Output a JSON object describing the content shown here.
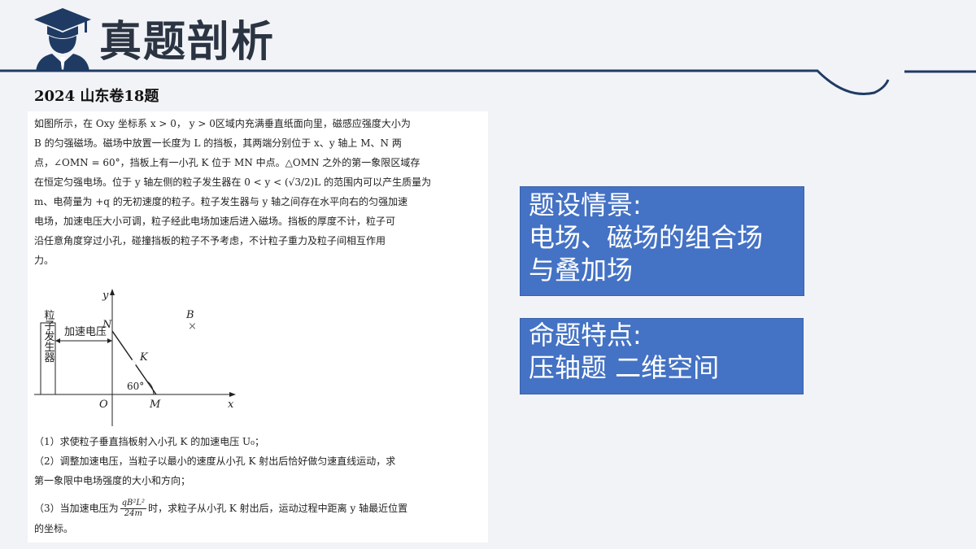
{
  "header": {
    "title": "真题剖析",
    "icon": "graduate-icon",
    "accent_color": "#1f3b63"
  },
  "subtitle": "2024 山东卷18题",
  "problem": {
    "lines": [
      "如图所示，在 Oxy 坐标系 x > 0，  y > 0区域内充满垂直纸面向里，磁感应强度大小为",
      "B 的匀强磁场。磁场中放置一长度为 L 的挡板，其两端分别位于 x、y 轴上 M、N 两",
      "点，∠OMN = 60°，挡板上有一小孔 K 位于 MN 中点。△OMN 之外的第一象限区域存",
      "在恒定匀强电场。位于 y 轴左侧的粒子发生器在 0 < y < (√3/2)L 的范围内可以产生质量为",
      "m、电荷量为 +q 的无初速度的粒子。粒子发生器与 y 轴之间存在水平向右的匀强加速",
      "电场，加速电压大小可调，粒子经此电场加速后进入磁场。挡板的厚度不计，粒子可",
      "沿任意角度穿过小孔，碰撞挡板的粒子不予考虑，不计粒子重力及粒子间相互作用",
      "力。"
    ],
    "diagram": {
      "generator_label": "粒子发生器",
      "voltage_label": "加速电压",
      "axis_y": "y",
      "axis_x": "x",
      "origin": "O",
      "point_n": "N",
      "point_m": "M",
      "point_k": "K",
      "field_b": "B",
      "field_mark": "×",
      "angle": "60°"
    },
    "q1": "（1）求使粒子垂直挡板射入小孔 K 的加速电压 U₀；",
    "q2a": "（2）调整加速电压，当粒子以最小的速度从小孔 K 射出后恰好做匀速直线运动，求",
    "q2b": "第一象限中电场强度的大小和方向；",
    "q3_pre": "（3）当加速电压为",
    "q3_num": "qB²L²",
    "q3_den": "24m",
    "q3_post": "时，求粒子从小孔 K 射出后，运动过程中距离 y 轴最近位置",
    "q3b": "的坐标。"
  },
  "boxes": {
    "scenario": {
      "line1": "题设情景:",
      "line2": "电场、磁场的组合场",
      "line3": "与叠加场"
    },
    "features": {
      "line1": "命题特点:",
      "line2": "压轴题  二维空间"
    },
    "box_color": "#4472c4"
  }
}
